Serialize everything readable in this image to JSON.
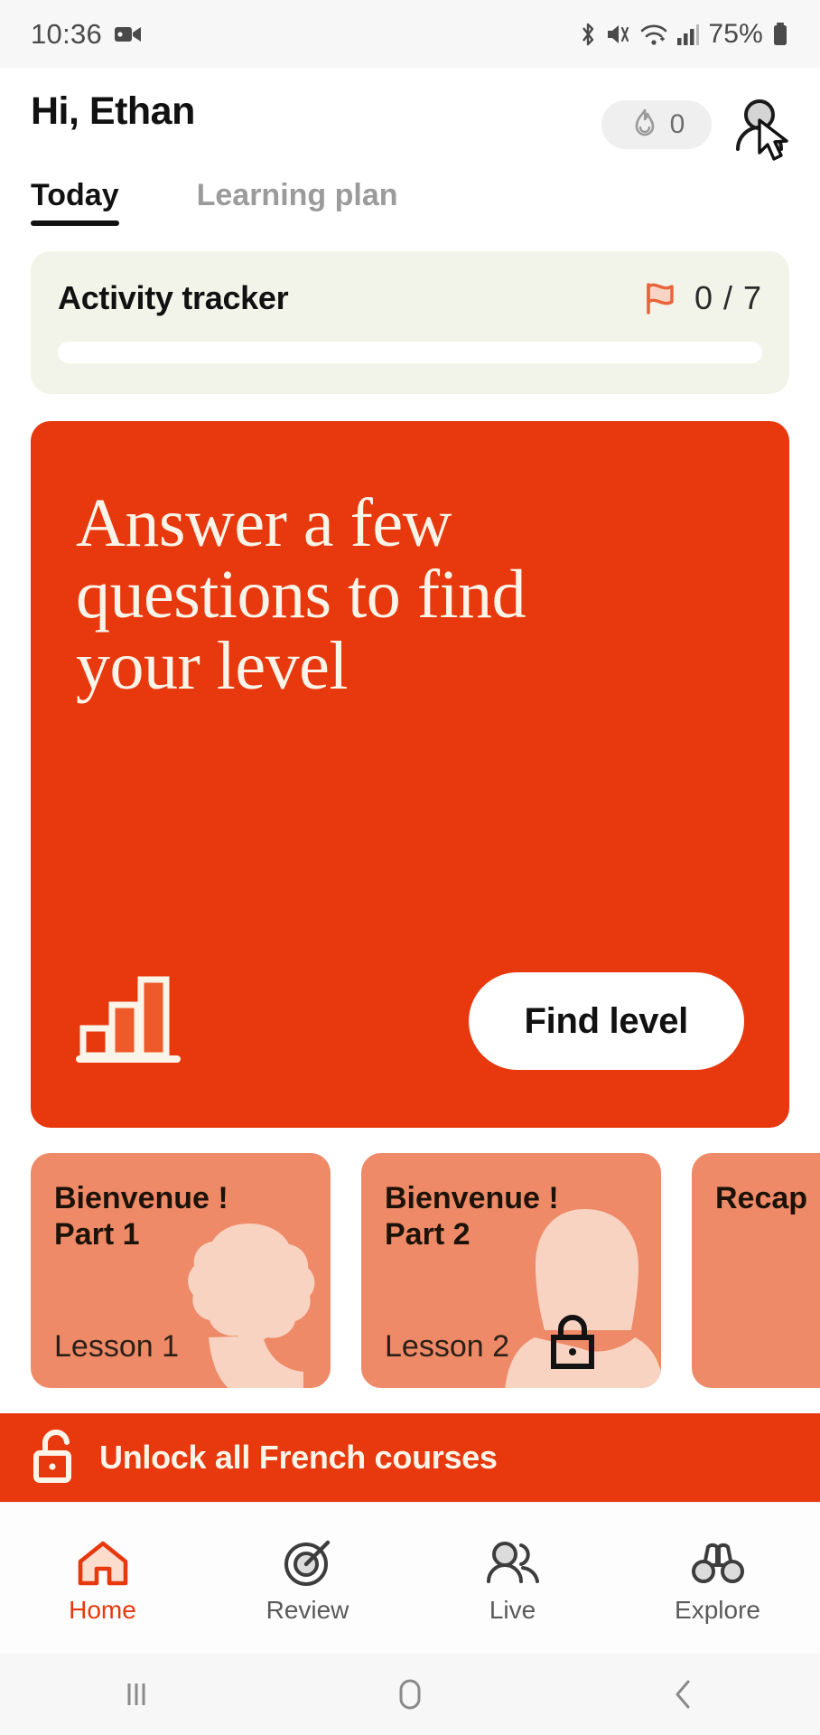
{
  "status_bar": {
    "time": "10:36",
    "battery_percent": "75%",
    "icons": [
      "video-camera-icon",
      "bluetooth-icon",
      "mute-icon",
      "wifi-icon",
      "cellular-signal-icon",
      "battery-icon"
    ]
  },
  "header": {
    "greeting": "Hi, Ethan",
    "streak_count": "0",
    "streak_icon": "flame-icon",
    "avatar_icon": "profile-avatar-icon"
  },
  "tabs": [
    {
      "label": "Today",
      "active": true
    },
    {
      "label": "Learning plan",
      "active": false
    }
  ],
  "tracker": {
    "title": "Activity tracker",
    "flag_icon": "flag-icon",
    "count": "0 / 7",
    "progress_percent": 0
  },
  "hero": {
    "title": "Answer a few questions to find your level",
    "icon": "bar-chart-icon",
    "button_label": "Find level",
    "background_color": "#E8380D"
  },
  "lessons": [
    {
      "title": "Bienvenue !\nPart 1",
      "subtitle": "Lesson 1",
      "locked": false,
      "silhouette": "curly-hair-person-silhouette"
    },
    {
      "title": "Bienvenue !\nPart 2",
      "subtitle": "Lesson 2",
      "locked": true,
      "silhouette": "long-hair-person-silhouette"
    },
    {
      "title": "Recap",
      "subtitle": "",
      "locked": false,
      "silhouette": ""
    }
  ],
  "unlock_banner": {
    "label": "Unlock all French courses",
    "icon": "open-padlock-icon",
    "background_color": "#E8380D"
  },
  "bottom_nav": [
    {
      "label": "Home",
      "icon": "home-icon",
      "active": true
    },
    {
      "label": "Review",
      "icon": "target-icon",
      "active": false
    },
    {
      "label": "Live",
      "icon": "people-icon",
      "active": false
    },
    {
      "label": "Explore",
      "icon": "binoculars-icon",
      "active": false
    }
  ],
  "android_nav": [
    {
      "icon": "recents-icon"
    },
    {
      "icon": "home-circle-icon"
    },
    {
      "icon": "back-chevron-icon"
    }
  ],
  "colors": {
    "brand_orange": "#E8380D",
    "card_salmon": "#EE8A67",
    "tracker_cream": "#F3F4E9",
    "hero_text_cream": "#FBF4E9"
  }
}
